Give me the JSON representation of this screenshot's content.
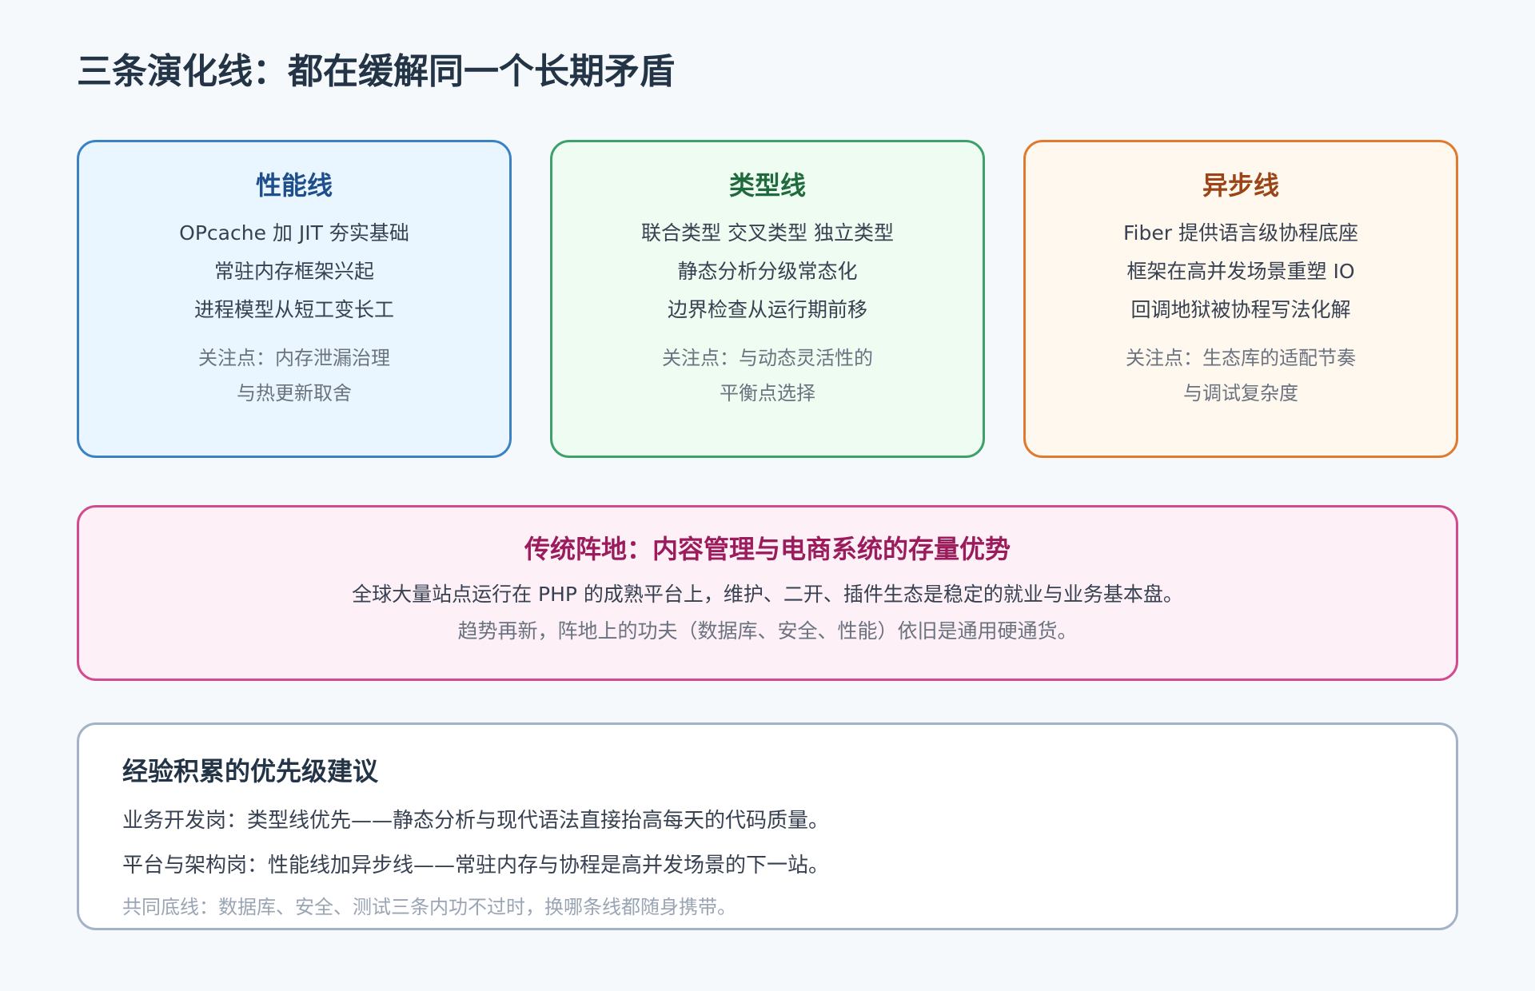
{
  "page": {
    "title": "三条演化线：都在缓解同一个长期矛盾"
  },
  "cards": {
    "performance": {
      "title": "性能线",
      "lines": [
        "OPcache 加 JIT 夯实基础",
        "常驻内存框架兴起",
        "进程模型从短工变长工"
      ],
      "focus": [
        "关注点：内存泄漏治理",
        "与热更新取舍"
      ]
    },
    "types": {
      "title": "类型线",
      "lines": [
        "联合类型 交叉类型 独立类型",
        "静态分析分级常态化",
        "边界检查从运行期前移"
      ],
      "focus": [
        "关注点：与动态灵活性的",
        "平衡点选择"
      ]
    },
    "async": {
      "title": "异步线",
      "lines": [
        "Fiber 提供语言级协程底座",
        "框架在高并发场景重塑 IO",
        "回调地狱被协程写法化解"
      ],
      "focus": [
        "关注点：生态库的适配节奏",
        "与调试复杂度"
      ]
    }
  },
  "base": {
    "title": "传统阵地：内容管理与电商系统的存量优势",
    "line1": "全球大量站点运行在 PHP 的成熟平台上，维护、二开、插件生态是稳定的就业与业务基本盘。",
    "line2": "趋势再新，阵地上的功夫（数据库、安全、性能）依旧是通用硬通货。"
  },
  "advice": {
    "title": "经验积累的优先级建议",
    "line1": "业务开发岗：类型线优先——静态分析与现代语法直接抬高每天的代码质量。",
    "line2": "平台与架构岗：性能线加异步线——常驻内存与协程是高并发场景的下一站。",
    "line3": "共同底线：数据库、安全、测试三条内功不过时，换哪条线都随身携带。"
  },
  "colors": {
    "performance_border": "#3b82c4",
    "types_border": "#3ea06a",
    "async_border": "#e07a2e",
    "base_border": "#d14b8e",
    "advice_border": "#a3b3c7"
  }
}
